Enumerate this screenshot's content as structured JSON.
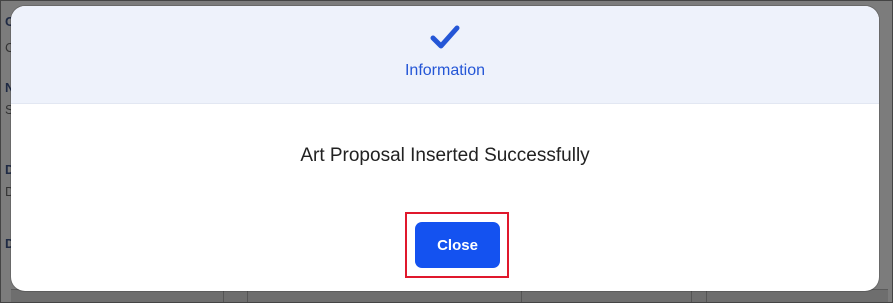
{
  "background": {
    "fragments": [
      "CA",
      "Ca",
      "N",
      "S",
      "D",
      "D",
      "D"
    ]
  },
  "modal": {
    "header": {
      "icon": "check-icon",
      "title": "Information",
      "accent_color": "#2456d6"
    },
    "message": "Art Proposal Inserted Successfully",
    "close_button_label": "Close",
    "button_color": "#1452f0",
    "highlight_color": "#e0182c"
  }
}
